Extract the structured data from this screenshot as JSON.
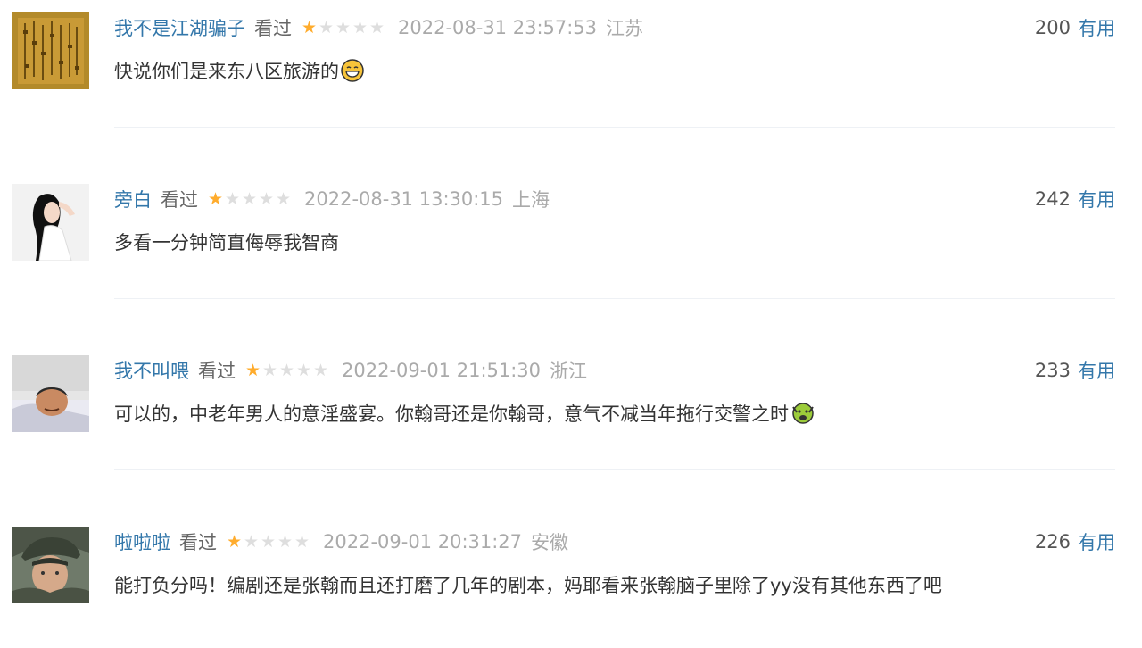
{
  "comments": [
    {
      "user": "我不是江湖骗子",
      "status": "看过",
      "rating": 1,
      "time": "2022-08-31 23:57:53",
      "location": "江苏",
      "votes": "200",
      "useful_label": "有用",
      "content": "快说你们是来东八区旅游的",
      "emoji": "grin-face-icon"
    },
    {
      "user": "旁白",
      "status": "看过",
      "rating": 1,
      "time": "2022-08-31 13:30:15",
      "location": "上海",
      "votes": "242",
      "useful_label": "有用",
      "content": "多看一分钟简直侮辱我智商",
      "emoji": ""
    },
    {
      "user": "我不叫喂",
      "status": "看过",
      "rating": 1,
      "time": "2022-09-01 21:51:30",
      "location": "浙江",
      "votes": "233",
      "useful_label": "有用",
      "content": "可以的，中老年男人的意淫盛宴。你翰哥还是你翰哥，意气不减当年拖行交警之时",
      "emoji": "scream-face-icon"
    },
    {
      "user": "啦啦啦",
      "status": "看过",
      "rating": 1,
      "time": "2022-09-01 20:31:27",
      "location": "安徽",
      "votes": "226",
      "useful_label": "有用",
      "content": "能打负分吗！编剧还是张翰而且还打磨了几年的剧本，妈耶看来张翰脑子里除了yy没有其他东西了吧",
      "emoji": ""
    }
  ],
  "colors": {
    "username": "#3377aa",
    "star_on": "#ffac2d",
    "star_off": "#dedede",
    "meta": "#aaaaaa"
  }
}
